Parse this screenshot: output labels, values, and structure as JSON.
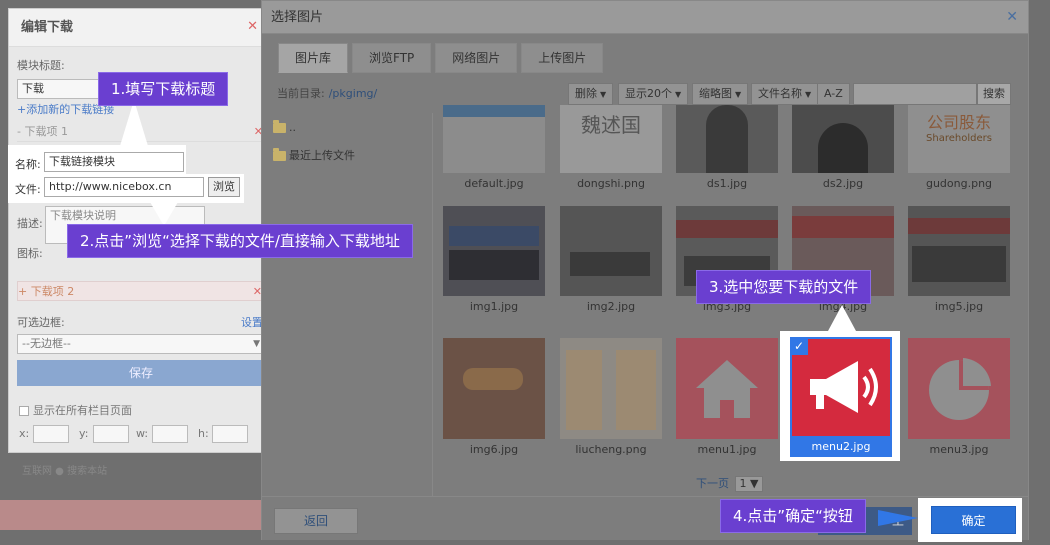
{
  "editor": {
    "title": "编辑下载",
    "close": "✕",
    "module_title_label": "模块标题:",
    "module_title_value": "下载",
    "add_link": "+添加新的下载链接",
    "item1_label": "- 下载项 1",
    "name_label": "名称:",
    "name_value": "下载链接模块",
    "file_label": "文件:",
    "file_value": "http://www.nicebox.cn",
    "browse_label": "浏览",
    "desc_label": "描述:",
    "desc_value": "下载模块说明",
    "icon_label": "图标:",
    "item2_label": "+ 下载项 2",
    "border_label": "可选边框:",
    "settings_link": "设置",
    "border_value": "--无边框--",
    "save_label": "保存",
    "show_all_label": "显示在所有栏目页面",
    "x_label": "x:",
    "y_label": "y:",
    "w_label": "w:",
    "h_label": "h:",
    "search_scope": "互联网 ● 搜索本站"
  },
  "dialog": {
    "title": "选择图片",
    "close": "✕",
    "tabs": [
      "图片库",
      "浏览FTP",
      "网络图片",
      "上传图片"
    ],
    "current_dir_label": "当前目录:",
    "current_dir_value": "/pkgimg/",
    "toolbar": {
      "delete": "删除",
      "per_page": "显示20个",
      "view": "缩略图",
      "sort": "文件名称",
      "order": "A-Z",
      "search": "搜索"
    },
    "sidebar": {
      "up": "..",
      "recent": "最近上传文件"
    },
    "files": [
      "default.jpg",
      "dongshi.png",
      "ds1.jpg",
      "ds2.jpg",
      "gudong.png",
      "img1.jpg",
      "img2.jpg",
      "img3.jpg",
      "img4.jpg",
      "img5.jpg",
      "img6.jpg",
      "liucheng.png",
      "menu1.jpg",
      "menu2.jpg",
      "menu3.jpg"
    ],
    "thumb_texts": {
      "dongshi": "魏述国",
      "gudong_cn": "公司股东",
      "gudong_en": "Shareholders"
    },
    "selected_file": "menu2.jpg",
    "pager": {
      "next": "下一页",
      "page": "1"
    },
    "back_label": "返回",
    "ok_label": "确定",
    "cancel_fragment": "工"
  },
  "callouts": {
    "step1": "1.填写下载标题",
    "step2": "2.点击”浏览“选择下载的文件/直接输入下载地址",
    "step3": "3.选中您要下载的文件",
    "step4": "4.点击”确定“按钮"
  },
  "colors": {
    "callout_bg": "#6a3fd0",
    "selected_blue": "#3177e6",
    "menu_red": "#d42a3e",
    "menu_dim_red": "#a5525c"
  }
}
